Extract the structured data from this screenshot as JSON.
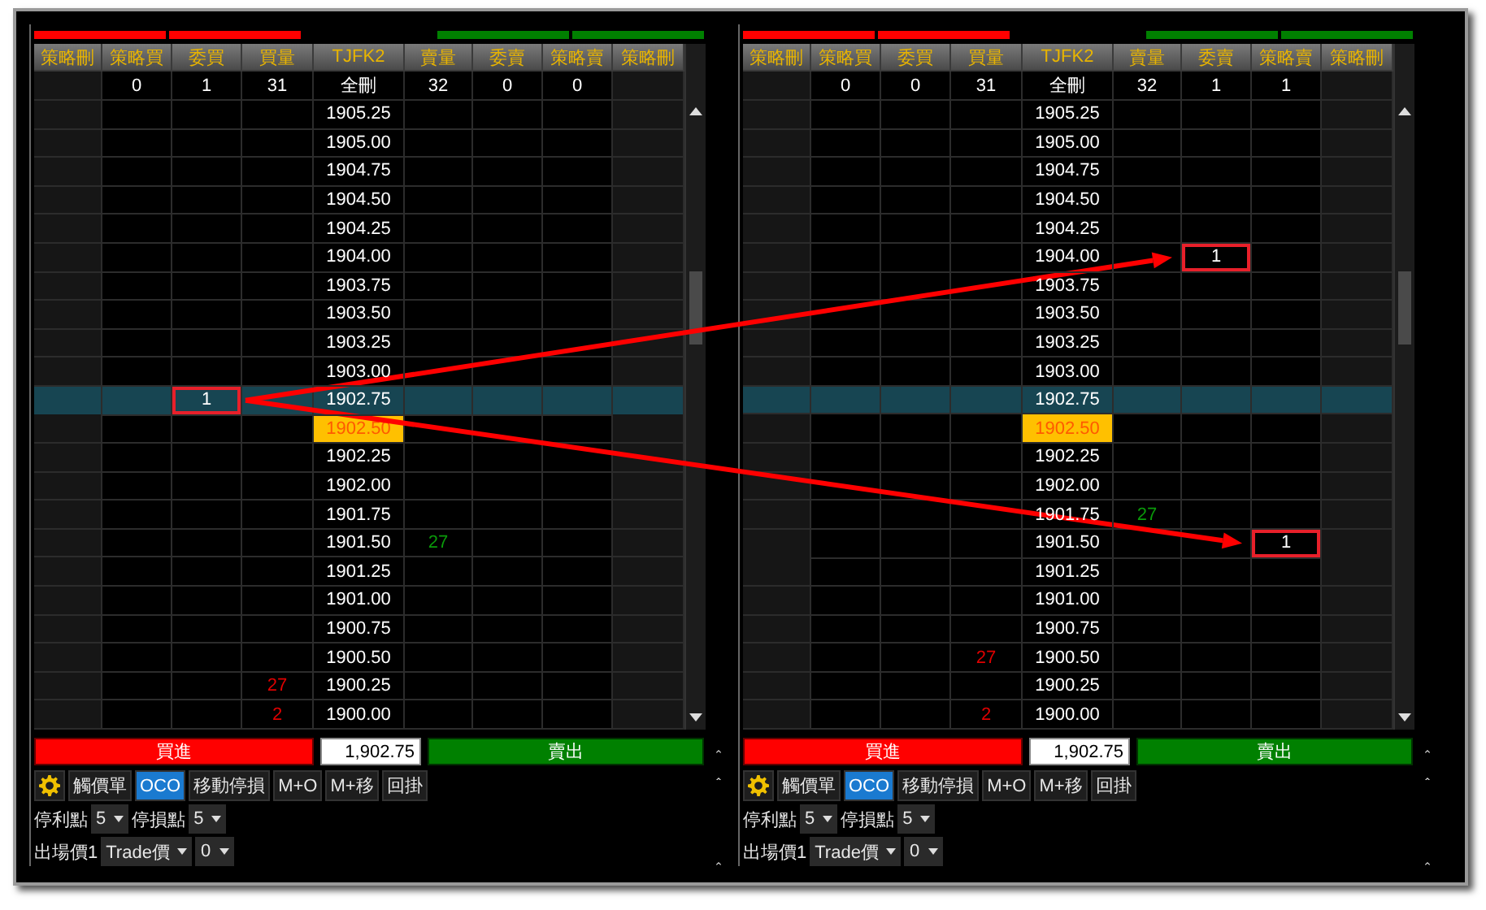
{
  "panels": [
    {
      "columns": [
        "策略刪",
        "策略買",
        "委買",
        "買量",
        "TJFK2",
        "賣量",
        "委賣",
        "策略賣",
        "策略刪"
      ],
      "summary": [
        "0",
        "1",
        "31",
        "全刪",
        "32",
        "0",
        "0"
      ],
      "rows": [
        {
          "selected": false,
          "last": false,
          "cells": [
            null,
            null,
            null,
            null,
            "1905.25",
            null,
            null,
            null,
            null
          ]
        },
        {
          "selected": false,
          "last": false,
          "cells": [
            null,
            null,
            null,
            null,
            "1905.00",
            null,
            null,
            null,
            null
          ]
        },
        {
          "selected": false,
          "last": false,
          "cells": [
            null,
            null,
            null,
            null,
            "1904.75",
            null,
            null,
            null,
            null
          ]
        },
        {
          "selected": false,
          "last": false,
          "cells": [
            null,
            null,
            null,
            null,
            "1904.50",
            null,
            null,
            null,
            null
          ]
        },
        {
          "selected": false,
          "last": false,
          "cells": [
            null,
            null,
            null,
            null,
            "1904.25",
            null,
            null,
            null,
            null
          ]
        },
        {
          "selected": false,
          "last": false,
          "cells": [
            null,
            null,
            null,
            null,
            "1904.00",
            null,
            null,
            null,
            null
          ]
        },
        {
          "selected": false,
          "last": false,
          "cells": [
            null,
            null,
            null,
            null,
            "1903.75",
            null,
            null,
            null,
            null
          ]
        },
        {
          "selected": false,
          "last": false,
          "cells": [
            null,
            null,
            null,
            null,
            "1903.50",
            null,
            null,
            null,
            null
          ]
        },
        {
          "selected": false,
          "last": false,
          "cells": [
            null,
            null,
            null,
            null,
            "1903.25",
            null,
            null,
            null,
            null
          ]
        },
        {
          "selected": false,
          "last": false,
          "cells": [
            null,
            null,
            null,
            null,
            "1903.00",
            null,
            null,
            null,
            null
          ]
        },
        {
          "selected": true,
          "last": false,
          "cells": [
            null,
            null,
            {
              "text": "1",
              "annotated": true
            },
            null,
            "1902.75",
            null,
            null,
            null,
            null
          ]
        },
        {
          "selected": false,
          "last": true,
          "cells": [
            null,
            null,
            null,
            null,
            "1902.50",
            null,
            null,
            null,
            null
          ]
        },
        {
          "selected": false,
          "last": false,
          "cells": [
            null,
            null,
            null,
            null,
            "1902.25",
            null,
            null,
            null,
            null
          ]
        },
        {
          "selected": false,
          "last": false,
          "cells": [
            null,
            null,
            null,
            null,
            "1902.00",
            null,
            null,
            null,
            null
          ]
        },
        {
          "selected": false,
          "last": false,
          "cells": [
            null,
            null,
            null,
            null,
            "1901.75",
            null,
            null,
            null,
            null
          ]
        },
        {
          "selected": false,
          "last": false,
          "cells": [
            null,
            null,
            null,
            null,
            "1901.50",
            "27",
            null,
            null,
            null
          ]
        },
        {
          "selected": false,
          "last": false,
          "cells": [
            null,
            null,
            null,
            null,
            "1901.25",
            null,
            null,
            null,
            null
          ]
        },
        {
          "selected": false,
          "last": false,
          "cells": [
            null,
            null,
            null,
            null,
            "1901.00",
            null,
            null,
            null,
            null
          ]
        },
        {
          "selected": false,
          "last": false,
          "cells": [
            null,
            null,
            null,
            null,
            "1900.75",
            null,
            null,
            null,
            null
          ]
        },
        {
          "selected": false,
          "last": false,
          "cells": [
            null,
            null,
            null,
            null,
            "1900.50",
            null,
            null,
            null,
            null
          ]
        },
        {
          "selected": false,
          "last": false,
          "cells": [
            null,
            null,
            null,
            "27",
            "1900.25",
            null,
            null,
            null,
            null
          ]
        },
        {
          "selected": false,
          "last": false,
          "cells": [
            null,
            null,
            null,
            "2",
            "1900.00",
            null,
            null,
            null,
            null
          ]
        }
      ],
      "order_bar": {
        "buy": "買進",
        "price": "1,902.75",
        "sell": "賣出"
      },
      "toolbar": [
        {
          "label": "觸價單",
          "selected": false
        },
        {
          "label": "OCO",
          "selected": true
        },
        {
          "label": "移動停損",
          "selected": false
        },
        {
          "label": "M+O",
          "selected": false
        },
        {
          "label": "M+移",
          "selected": false
        },
        {
          "label": "回掛",
          "selected": false
        }
      ],
      "settings": [
        [
          {
            "kind": "label",
            "text": "停利點"
          },
          {
            "kind": "select",
            "value": "5"
          },
          {
            "kind": "label",
            "text": "停損點"
          },
          {
            "kind": "select",
            "value": "5"
          }
        ],
        [
          {
            "kind": "label",
            "text": "出場價1"
          },
          {
            "kind": "select",
            "value": "Trade價"
          },
          {
            "kind": "select",
            "value": "0"
          }
        ]
      ]
    },
    {
      "columns": [
        "策略刪",
        "策略買",
        "委買",
        "買量",
        "TJFK2",
        "賣量",
        "委賣",
        "策略賣",
        "策略刪"
      ],
      "summary": [
        "0",
        "0",
        "31",
        "全刪",
        "32",
        "1",
        "1"
      ],
      "rows": [
        {
          "selected": false,
          "last": false,
          "cells": [
            null,
            null,
            null,
            null,
            "1905.25",
            null,
            null,
            null,
            null
          ]
        },
        {
          "selected": false,
          "last": false,
          "cells": [
            null,
            null,
            null,
            null,
            "1905.00",
            null,
            null,
            null,
            null
          ]
        },
        {
          "selected": false,
          "last": false,
          "cells": [
            null,
            null,
            null,
            null,
            "1904.75",
            null,
            null,
            null,
            null
          ]
        },
        {
          "selected": false,
          "last": false,
          "cells": [
            null,
            null,
            null,
            null,
            "1904.50",
            null,
            null,
            null,
            null
          ]
        },
        {
          "selected": false,
          "last": false,
          "cells": [
            null,
            null,
            null,
            null,
            "1904.25",
            null,
            null,
            null,
            null
          ]
        },
        {
          "selected": false,
          "last": false,
          "cells": [
            null,
            null,
            null,
            null,
            "1904.00",
            null,
            {
              "text": "1",
              "annotated": true
            },
            null,
            null
          ]
        },
        {
          "selected": false,
          "last": false,
          "cells": [
            null,
            null,
            null,
            null,
            "1903.75",
            null,
            null,
            null,
            null
          ]
        },
        {
          "selected": false,
          "last": false,
          "cells": [
            null,
            null,
            null,
            null,
            "1903.50",
            null,
            null,
            null,
            null
          ]
        },
        {
          "selected": false,
          "last": false,
          "cells": [
            null,
            null,
            null,
            null,
            "1903.25",
            null,
            null,
            null,
            null
          ]
        },
        {
          "selected": false,
          "last": false,
          "cells": [
            null,
            null,
            null,
            null,
            "1903.00",
            null,
            null,
            null,
            null
          ]
        },
        {
          "selected": true,
          "last": false,
          "cells": [
            null,
            null,
            null,
            null,
            "1902.75",
            null,
            null,
            null,
            null
          ]
        },
        {
          "selected": false,
          "last": true,
          "cells": [
            null,
            null,
            null,
            null,
            "1902.50",
            null,
            null,
            null,
            null
          ]
        },
        {
          "selected": false,
          "last": false,
          "cells": [
            null,
            null,
            null,
            null,
            "1902.25",
            null,
            null,
            null,
            null
          ]
        },
        {
          "selected": false,
          "last": false,
          "cells": [
            null,
            null,
            null,
            null,
            "1902.00",
            null,
            null,
            null,
            null
          ]
        },
        {
          "selected": false,
          "last": false,
          "cells": [
            null,
            null,
            null,
            null,
            "1901.75",
            "27",
            null,
            null,
            null
          ]
        },
        {
          "selected": false,
          "last": false,
          "cells": [
            null,
            null,
            null,
            null,
            "1901.50",
            null,
            null,
            {
              "text": "1",
              "annotated": true
            },
            null
          ]
        },
        {
          "selected": false,
          "last": false,
          "cells": [
            null,
            null,
            null,
            null,
            "1901.25",
            null,
            null,
            null,
            null
          ]
        },
        {
          "selected": false,
          "last": false,
          "cells": [
            null,
            null,
            null,
            null,
            "1901.00",
            null,
            null,
            null,
            null
          ]
        },
        {
          "selected": false,
          "last": false,
          "cells": [
            null,
            null,
            null,
            null,
            "1900.75",
            null,
            null,
            null,
            null
          ]
        },
        {
          "selected": false,
          "last": false,
          "cells": [
            null,
            null,
            null,
            "27",
            "1900.50",
            null,
            null,
            null,
            null
          ]
        },
        {
          "selected": false,
          "last": false,
          "cells": [
            null,
            null,
            null,
            null,
            "1900.25",
            null,
            null,
            null,
            null
          ]
        },
        {
          "selected": false,
          "last": false,
          "cells": [
            null,
            null,
            null,
            "2",
            "1900.00",
            null,
            null,
            null,
            null
          ]
        }
      ],
      "order_bar": {
        "buy": "買進",
        "price": "1,902.75",
        "sell": "賣出"
      },
      "toolbar": [
        {
          "label": "觸價單",
          "selected": false
        },
        {
          "label": "OCO",
          "selected": true
        },
        {
          "label": "移動停損",
          "selected": false
        },
        {
          "label": "M+O",
          "selected": false
        },
        {
          "label": "M+移",
          "selected": false
        },
        {
          "label": "回掛",
          "selected": false
        }
      ],
      "settings": [
        [
          {
            "kind": "label",
            "text": "停利點"
          },
          {
            "kind": "select",
            "value": "5"
          },
          {
            "kind": "label",
            "text": "停損點"
          },
          {
            "kind": "select",
            "value": "5"
          }
        ],
        [
          {
            "kind": "label",
            "text": "出場價1"
          },
          {
            "kind": "select",
            "value": "Trade價"
          },
          {
            "kind": "select",
            "value": "0"
          }
        ]
      ]
    }
  ]
}
